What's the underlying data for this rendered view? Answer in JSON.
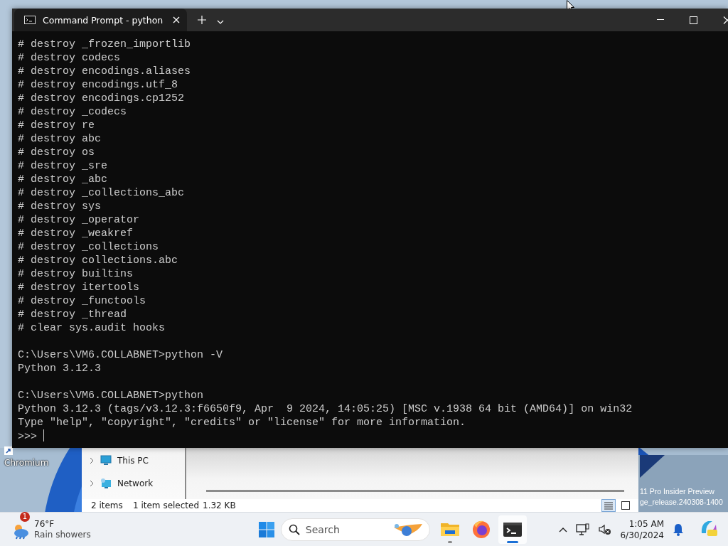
{
  "desktop": {
    "icons": [
      {
        "label": "Chromium"
      }
    ],
    "watermark": [
      "11 Pro Insider Preview",
      "ge_release.240308-1400"
    ]
  },
  "terminal": {
    "title": "Command Prompt - python",
    "blocks": [
      [
        "# destroy _frozen_importlib",
        "# destroy codecs",
        "# destroy encodings.aliases",
        "# destroy encodings.utf_8",
        "# destroy encodings.cp1252",
        "# destroy _codecs",
        "# destroy re",
        "# destroy abc",
        "# destroy os",
        "# destroy _sre",
        "# destroy _abc",
        "# destroy _collections_abc",
        "# destroy sys",
        "# destroy _operator",
        "# destroy _weakref",
        "# destroy _collections",
        "# destroy collections.abc",
        "# destroy builtins",
        "# destroy itertools",
        "# destroy _functools",
        "# destroy _thread",
        "# clear sys.audit hooks"
      ],
      [
        "C:\\Users\\VM6.COLLABNET>python -V",
        "Python 3.12.3"
      ],
      [
        "C:\\Users\\VM6.COLLABNET>python",
        "Python 3.12.3 (tags/v3.12.3:f6650f9, Apr  9 2024, 14:05:25) [MSC v.1938 64 bit (AMD64)] on win32",
        "Type \"help\", \"copyright\", \"credits\" or \"license\" for more information."
      ]
    ],
    "prompt": ">>>"
  },
  "explorer": {
    "nav_items": [
      {
        "label": "This PC",
        "kind": "pc"
      },
      {
        "label": "Network",
        "kind": "network"
      }
    ],
    "status": {
      "item_count": "2 items",
      "selection": "1 item selected",
      "size": "1.32 KB"
    },
    "view_buttons": [
      {
        "kind": "details",
        "selected": true
      },
      {
        "kind": "tiles",
        "selected": false
      }
    ]
  },
  "taskbar": {
    "weather": {
      "badge": "1",
      "temperature": "76°F",
      "condition": "Rain showers"
    },
    "search": {
      "placeholder": "Search"
    },
    "apps": [
      {
        "kind": "explorer",
        "running": true,
        "active": false
      },
      {
        "kind": "firefox",
        "running": false,
        "active": false
      },
      {
        "kind": "terminal",
        "running": true,
        "active": true
      }
    ],
    "clock": {
      "time": "1:05 AM",
      "date": "6/30/2024"
    }
  }
}
